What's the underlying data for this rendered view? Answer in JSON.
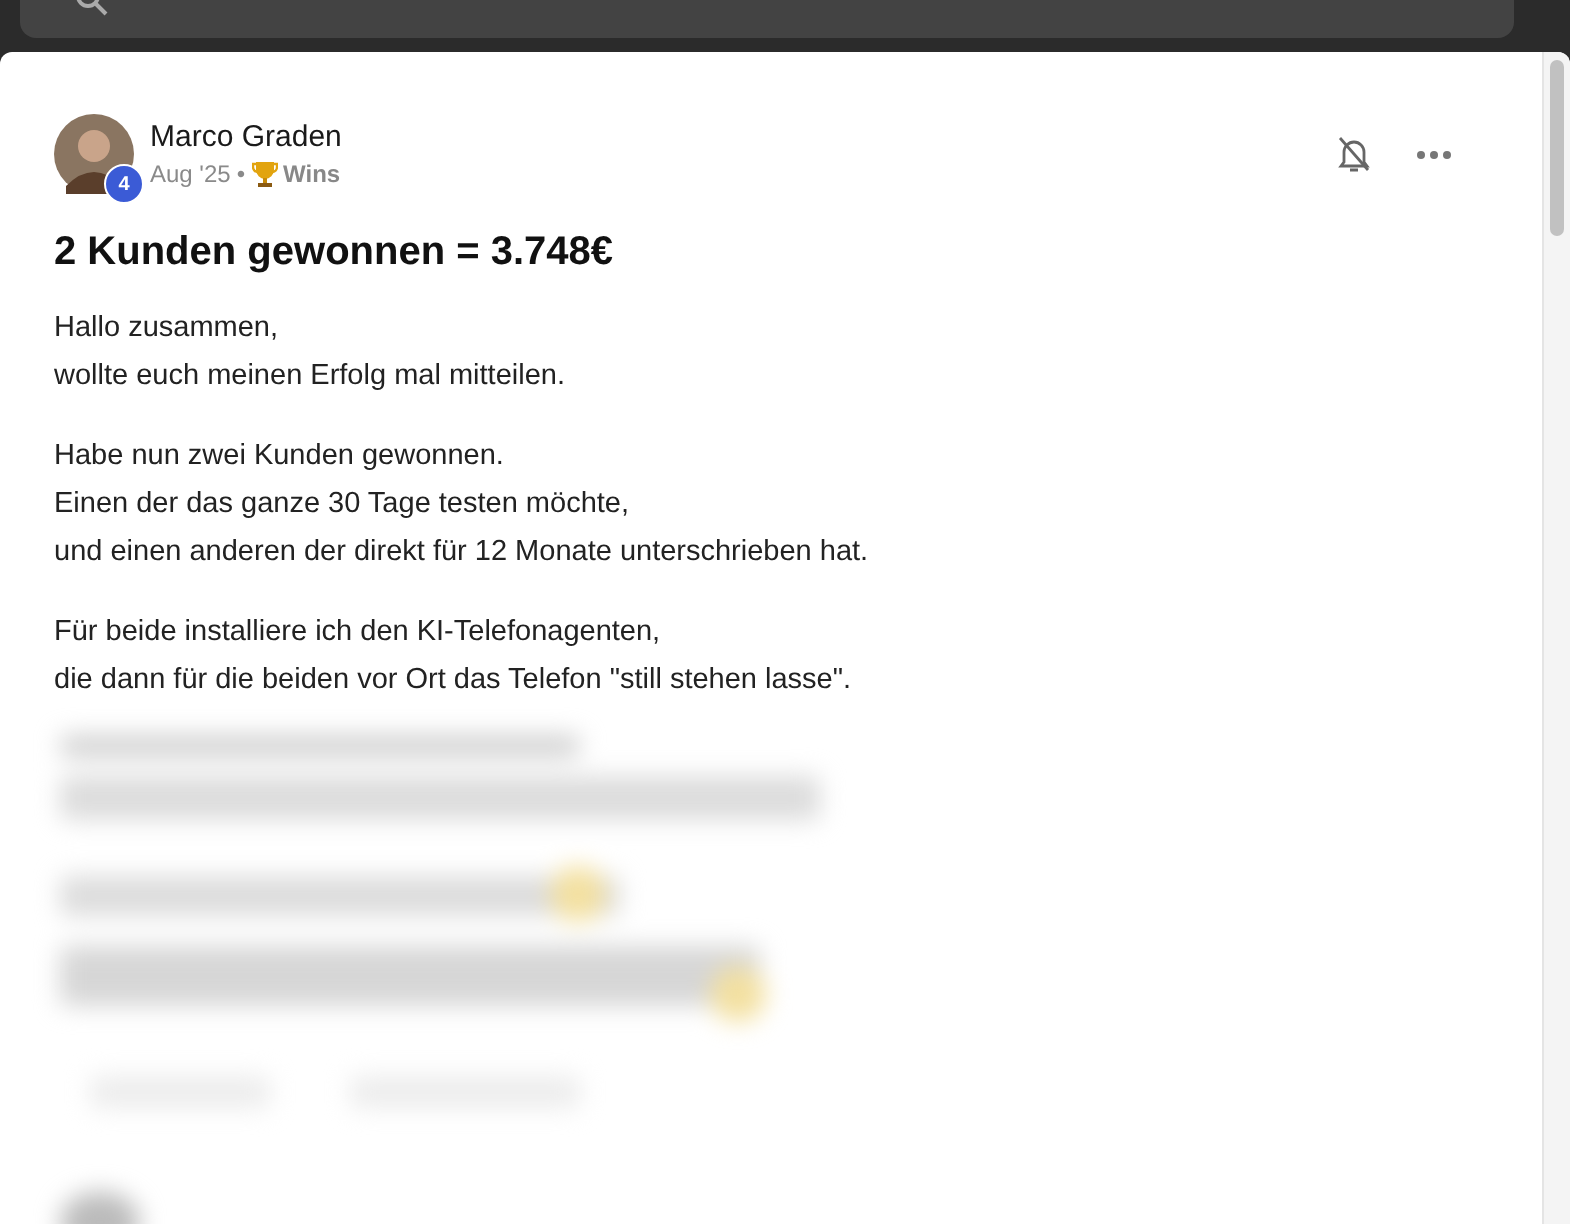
{
  "post": {
    "author": "Marco Graden",
    "level_badge": "4",
    "date": "Aug '25",
    "separator": "•",
    "category": "Wins",
    "title": "2 Kunden gewonnen = 3.748€",
    "paragraphs": [
      [
        "Hallo zusammen,",
        "wollte euch meinen Erfolg mal mitteilen."
      ],
      [
        "Habe nun zwei Kunden gewonnen.",
        "Einen der das ganze 30 Tage testen möchte,",
        "und einen anderen der direkt für 12 Monate unterschrieben hat."
      ],
      [
        "Für beide installiere ich den KI-Telefonagenten,",
        "die dann für die beiden vor Ort das Telefon \"still stehen lasse\"."
      ]
    ]
  }
}
